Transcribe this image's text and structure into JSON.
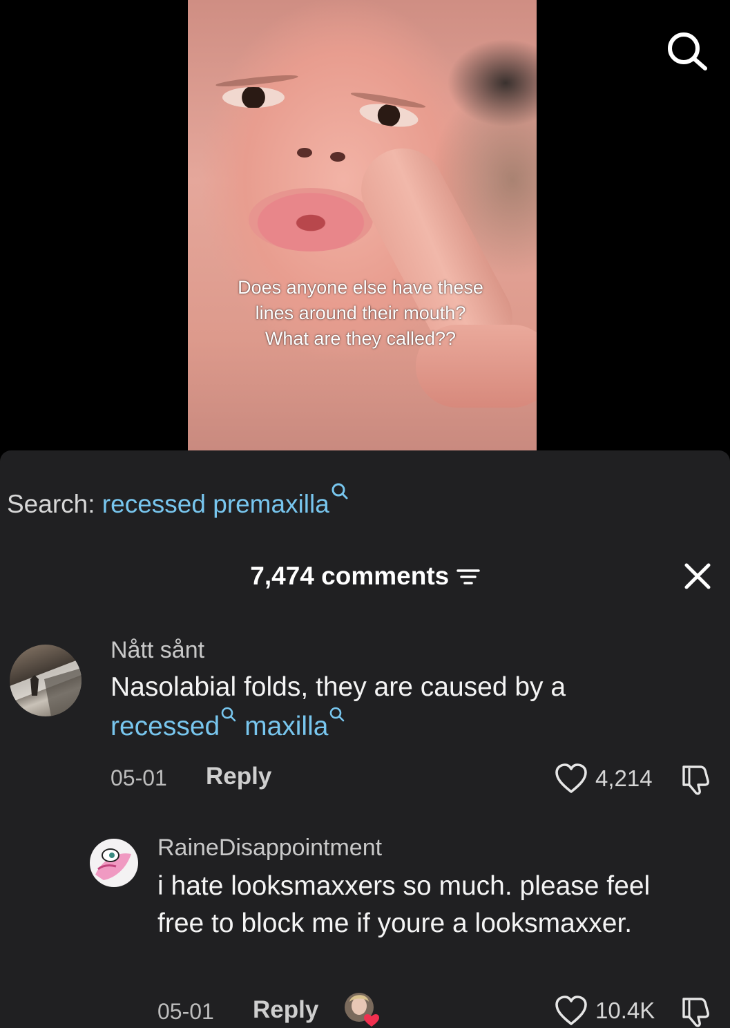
{
  "video": {
    "caption": "Does anyone else have these lines around their mouth? What are they called??"
  },
  "top_bar": {
    "search_icon": "search-icon"
  },
  "search_suggestion": {
    "prefix": "Search:",
    "term": "recessed premaxilla",
    "icon": "search-icon"
  },
  "comments_header": {
    "count_label": "7,474 comments",
    "filter_icon": "filter-icon",
    "close_icon": "close-icon"
  },
  "comments": [
    {
      "username": "Nått sånt",
      "text_plain": "Nasolabial folds, they are caused by a",
      "link_1": "recessed",
      "link_2": "maxilla",
      "date": "05-01",
      "reply_label": "Reply",
      "likes": "4,214"
    },
    {
      "username": "RaineDisappointment",
      "text": "i hate looksmaxxers so much. please feel free to block me if youre a looksmaxxer.",
      "date": "05-01",
      "reply_label": "Reply",
      "likes": "10.4K"
    }
  ],
  "colors": {
    "sheet_bg": "#202022",
    "link": "#78c6ee",
    "background": "#000000"
  }
}
